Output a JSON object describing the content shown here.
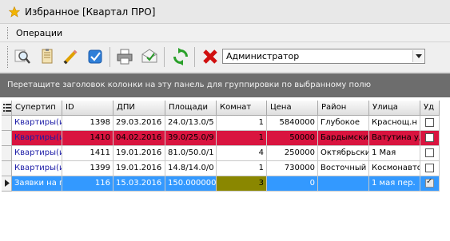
{
  "window": {
    "title": "Избранное [Квартал ПРО]"
  },
  "menu": {
    "items": [
      "Операции"
    ]
  },
  "toolbar": {
    "icons": [
      "search-icon",
      "notes-icon",
      "edit-pencil-icon",
      "checkbox-icon",
      "print-icon",
      "mail-icon",
      "refresh-icon",
      "delete-icon"
    ],
    "user_select": {
      "value": "Администратор"
    }
  },
  "group_panel": {
    "text": "Перетащите заголовок колонки на эту панель для группировки по выбранному полю"
  },
  "table": {
    "columns": [
      "Супертип",
      "ID",
      "ДПИ",
      "Площади",
      "Комнат",
      "Цена",
      "Район",
      "Улица",
      "Уд"
    ],
    "rows": [
      {
        "supertype": "Квартиры(и",
        "id": "1398",
        "dpi": "29.03.2016",
        "area": "24.0/13.0/5",
        "rooms": "1",
        "price": "5840000",
        "district": "Глубокое",
        "street": "Краснощ.н",
        "deleted": false
      },
      {
        "supertype": "Квартиры(и",
        "id": "1410",
        "dpi": "04.02.2016",
        "area": "39.0/25.0/9",
        "rooms": "1",
        "price": "50000",
        "district": "Бардымский",
        "street": "Ватутина уд",
        "deleted": false
      },
      {
        "supertype": "Квартиры(и",
        "id": "1411",
        "dpi": "19.01.2016",
        "area": "81.0/50.0/1",
        "rooms": "4",
        "price": "250000",
        "district": "Октябрьский",
        "street": "1 Мая",
        "deleted": false
      },
      {
        "supertype": "Квартиры(и",
        "id": "1399",
        "dpi": "19.01.2016",
        "area": "14.8/14.0/0",
        "rooms": "1",
        "price": "730000",
        "district": "Восточный",
        "street": "Космонавто",
        "deleted": false
      },
      {
        "supertype": "Заявки на п",
        "id": "116",
        "dpi": "15.03.2016",
        "area": "150.000000",
        "rooms": "3",
        "price": "0",
        "district": "",
        "street": "1 мая пер.",
        "deleted": true
      }
    ]
  },
  "colors": {
    "highlight_row": "#d9143f",
    "selected_row": "#3399ff",
    "selected_rooms_cell": "#8a8700",
    "link_text": "#1a1aa6"
  }
}
